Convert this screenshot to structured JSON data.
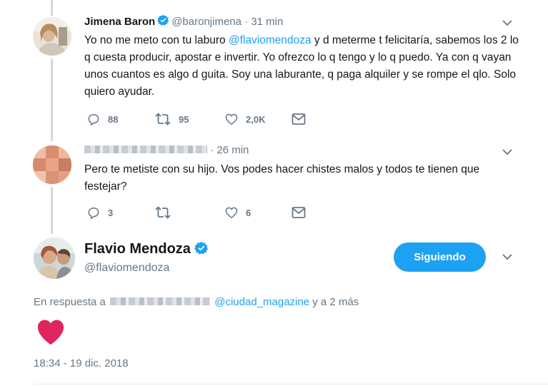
{
  "tweets": [
    {
      "name": "Jimena Baron",
      "handle": "@baronjimena",
      "time": "31 min",
      "text_before_mention": "Yo no me meto con tu laburo ",
      "mention": "@flaviomendoza",
      "text_after_mention": " y d meterme t felicitaría, sabemos los 2 lo q cuesta producir, apostar e invertir. Yo ofrezco lo q tengo y lo q puedo. Ya con q vayan unos cuantos es algo d guita. Soy una laburante, q paga alquiler y se rompe el qlo. Solo quiero ayudar.",
      "replies": "88",
      "retweets": "95",
      "likes": "2,0K"
    },
    {
      "time": "26 min",
      "text": "Pero te metiste con su hijo. Vos podes hacer chistes malos y todos te tienen que festejar?",
      "replies": "3",
      "retweets": "",
      "likes": "6"
    }
  ],
  "main_tweet": {
    "name": "Flavio Mendoza",
    "handle": "@flaviomendoza",
    "follow_label": "Siguiendo",
    "reply_prefix": "En respuesta a",
    "reply_mention": "@ciudad_magazine",
    "reply_suffix": "y a 2 más",
    "timestamp": "18:34 - 19 dic. 2018"
  },
  "colors": {
    "accent": "#1da1f2",
    "muted": "#657786",
    "heart": "#e0245e"
  },
  "icons": [
    "verified-badge-icon",
    "chevron-down-icon",
    "reply-icon",
    "retweet-icon",
    "like-icon",
    "direct-message-icon",
    "heart-emoji-icon"
  ]
}
